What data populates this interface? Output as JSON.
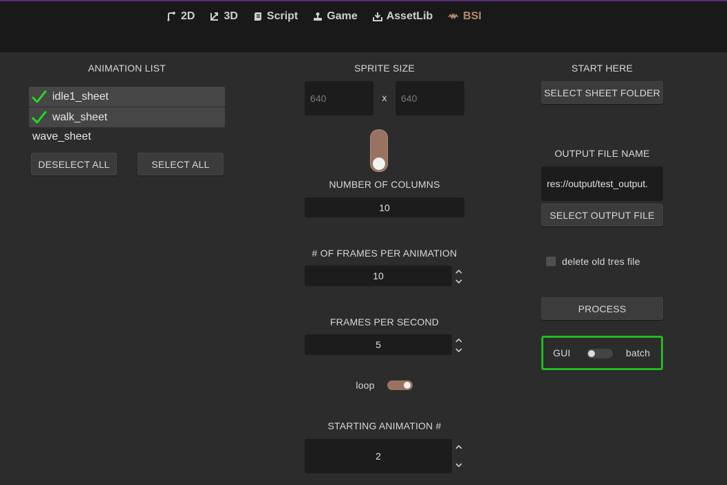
{
  "tabs": [
    {
      "label": "2D",
      "icon": "2d-icon",
      "active": false
    },
    {
      "label": "3D",
      "icon": "3d-icon",
      "active": false
    },
    {
      "label": "Script",
      "icon": "script-icon",
      "active": false
    },
    {
      "label": "Game",
      "icon": "game-icon",
      "active": false
    },
    {
      "label": "AssetLib",
      "icon": "assetlib-icon",
      "active": false
    },
    {
      "label": "BSI",
      "icon": "bsi-plugin-icon",
      "active": true
    }
  ],
  "animation_list": {
    "title": "ANIMATION LIST",
    "items": [
      {
        "label": "idle1_sheet",
        "selected": true
      },
      {
        "label": "walk_sheet",
        "selected": true
      },
      {
        "label": "wave_sheet",
        "selected": false
      }
    ],
    "deselect_all": "DESELECT ALL",
    "select_all": "SELECT ALL"
  },
  "sprite_size": {
    "title": "SPRITE SIZE",
    "width_placeholder": "640",
    "height_placeholder": "640",
    "separator": "x"
  },
  "columns": {
    "title": "NUMBER OF COLUMNS",
    "value": "10"
  },
  "frames_per_animation": {
    "title": "# OF FRAMES PER ANIMATION",
    "value": "10"
  },
  "fps": {
    "title": "FRAMES PER SECOND",
    "value": "5"
  },
  "loop": {
    "label": "loop",
    "on": true
  },
  "starting_animation": {
    "title": "STARTING ANIMATION #",
    "value": "2"
  },
  "start_here": {
    "title": "START HERE",
    "select_sheet_folder": "SELECT SHEET FOLDER"
  },
  "output": {
    "title": "OUTPUT FILE NAME",
    "path": "res://output/test_output.",
    "select_output_file": "SELECT OUTPUT FILE"
  },
  "delete_old": {
    "label": "delete old tres file",
    "checked": false
  },
  "process": {
    "label": "PROCESS"
  },
  "mode": {
    "left_label": "GUI",
    "right_label": "batch",
    "batch_on": false
  },
  "colors": {
    "accent": "#9a7260",
    "active_tab": "#b5886a",
    "check_green": "#22dd22",
    "mode_border": "#22bb22",
    "background": "#2c2c2c",
    "topbar": "#191919"
  }
}
